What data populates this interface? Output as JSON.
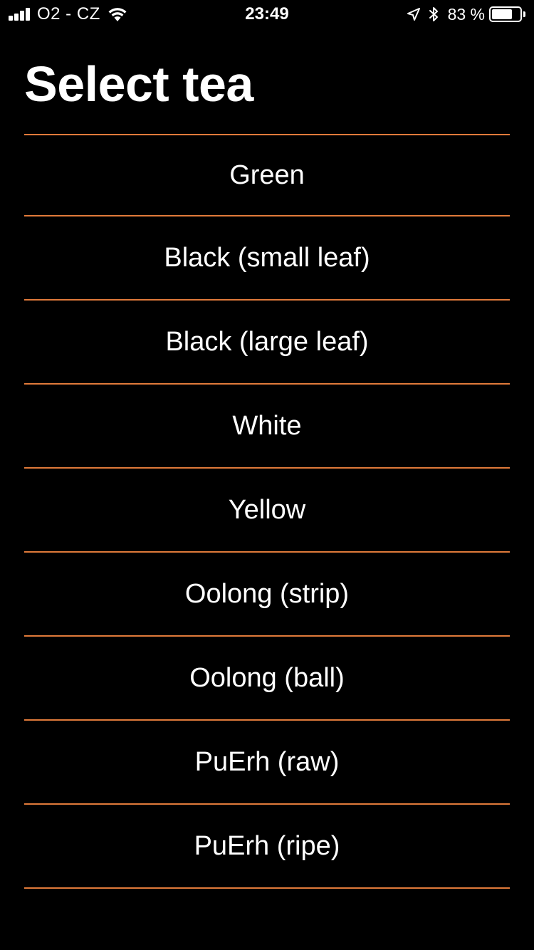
{
  "status_bar": {
    "carrier": "O2 - CZ",
    "time": "23:49",
    "battery_percent_text": "83 %",
    "battery_level": 0.83,
    "signal_bars_filled": 4,
    "signal_bars_total": 4,
    "icons": [
      "signal-icon",
      "wifi-icon",
      "location-arrow-icon",
      "bluetooth-icon",
      "battery-icon"
    ]
  },
  "title": "Select tea",
  "colors": {
    "background": "#000000",
    "text": "#ffffff",
    "accent": "#e07a3a"
  },
  "tea_list": [
    {
      "label": "Green"
    },
    {
      "label": "Black (small leaf)"
    },
    {
      "label": "Black (large leaf)"
    },
    {
      "label": "White"
    },
    {
      "label": "Yellow"
    },
    {
      "label": "Oolong (strip)"
    },
    {
      "label": "Oolong (ball)"
    },
    {
      "label": "PuErh (raw)"
    },
    {
      "label": "PuErh (ripe)"
    }
  ]
}
